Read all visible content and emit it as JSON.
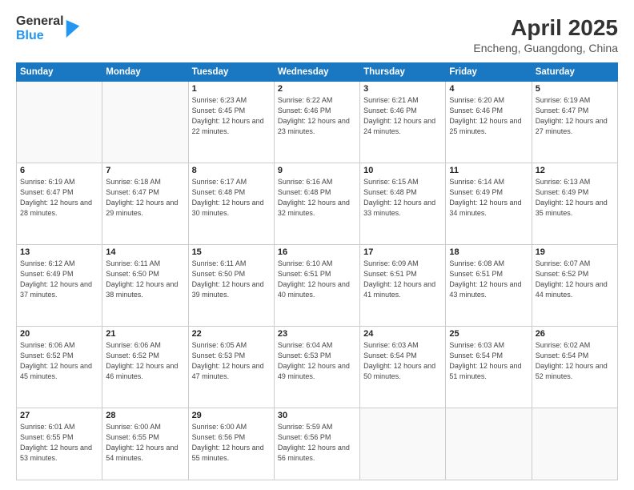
{
  "logo": {
    "general": "General",
    "blue": "Blue"
  },
  "header": {
    "title": "April 2025",
    "subtitle": "Encheng, Guangdong, China"
  },
  "weekdays": [
    "Sunday",
    "Monday",
    "Tuesday",
    "Wednesday",
    "Thursday",
    "Friday",
    "Saturday"
  ],
  "weeks": [
    [
      {
        "day": "",
        "detail": ""
      },
      {
        "day": "",
        "detail": ""
      },
      {
        "day": "1",
        "detail": "Sunrise: 6:23 AM\nSunset: 6:45 PM\nDaylight: 12 hours and 22 minutes."
      },
      {
        "day": "2",
        "detail": "Sunrise: 6:22 AM\nSunset: 6:46 PM\nDaylight: 12 hours and 23 minutes."
      },
      {
        "day": "3",
        "detail": "Sunrise: 6:21 AM\nSunset: 6:46 PM\nDaylight: 12 hours and 24 minutes."
      },
      {
        "day": "4",
        "detail": "Sunrise: 6:20 AM\nSunset: 6:46 PM\nDaylight: 12 hours and 25 minutes."
      },
      {
        "day": "5",
        "detail": "Sunrise: 6:19 AM\nSunset: 6:47 PM\nDaylight: 12 hours and 27 minutes."
      }
    ],
    [
      {
        "day": "6",
        "detail": "Sunrise: 6:19 AM\nSunset: 6:47 PM\nDaylight: 12 hours and 28 minutes."
      },
      {
        "day": "7",
        "detail": "Sunrise: 6:18 AM\nSunset: 6:47 PM\nDaylight: 12 hours and 29 minutes."
      },
      {
        "day": "8",
        "detail": "Sunrise: 6:17 AM\nSunset: 6:48 PM\nDaylight: 12 hours and 30 minutes."
      },
      {
        "day": "9",
        "detail": "Sunrise: 6:16 AM\nSunset: 6:48 PM\nDaylight: 12 hours and 32 minutes."
      },
      {
        "day": "10",
        "detail": "Sunrise: 6:15 AM\nSunset: 6:48 PM\nDaylight: 12 hours and 33 minutes."
      },
      {
        "day": "11",
        "detail": "Sunrise: 6:14 AM\nSunset: 6:49 PM\nDaylight: 12 hours and 34 minutes."
      },
      {
        "day": "12",
        "detail": "Sunrise: 6:13 AM\nSunset: 6:49 PM\nDaylight: 12 hours and 35 minutes."
      }
    ],
    [
      {
        "day": "13",
        "detail": "Sunrise: 6:12 AM\nSunset: 6:49 PM\nDaylight: 12 hours and 37 minutes."
      },
      {
        "day": "14",
        "detail": "Sunrise: 6:11 AM\nSunset: 6:50 PM\nDaylight: 12 hours and 38 minutes."
      },
      {
        "day": "15",
        "detail": "Sunrise: 6:11 AM\nSunset: 6:50 PM\nDaylight: 12 hours and 39 minutes."
      },
      {
        "day": "16",
        "detail": "Sunrise: 6:10 AM\nSunset: 6:51 PM\nDaylight: 12 hours and 40 minutes."
      },
      {
        "day": "17",
        "detail": "Sunrise: 6:09 AM\nSunset: 6:51 PM\nDaylight: 12 hours and 41 minutes."
      },
      {
        "day": "18",
        "detail": "Sunrise: 6:08 AM\nSunset: 6:51 PM\nDaylight: 12 hours and 43 minutes."
      },
      {
        "day": "19",
        "detail": "Sunrise: 6:07 AM\nSunset: 6:52 PM\nDaylight: 12 hours and 44 minutes."
      }
    ],
    [
      {
        "day": "20",
        "detail": "Sunrise: 6:06 AM\nSunset: 6:52 PM\nDaylight: 12 hours and 45 minutes."
      },
      {
        "day": "21",
        "detail": "Sunrise: 6:06 AM\nSunset: 6:52 PM\nDaylight: 12 hours and 46 minutes."
      },
      {
        "day": "22",
        "detail": "Sunrise: 6:05 AM\nSunset: 6:53 PM\nDaylight: 12 hours and 47 minutes."
      },
      {
        "day": "23",
        "detail": "Sunrise: 6:04 AM\nSunset: 6:53 PM\nDaylight: 12 hours and 49 minutes."
      },
      {
        "day": "24",
        "detail": "Sunrise: 6:03 AM\nSunset: 6:54 PM\nDaylight: 12 hours and 50 minutes."
      },
      {
        "day": "25",
        "detail": "Sunrise: 6:03 AM\nSunset: 6:54 PM\nDaylight: 12 hours and 51 minutes."
      },
      {
        "day": "26",
        "detail": "Sunrise: 6:02 AM\nSunset: 6:54 PM\nDaylight: 12 hours and 52 minutes."
      }
    ],
    [
      {
        "day": "27",
        "detail": "Sunrise: 6:01 AM\nSunset: 6:55 PM\nDaylight: 12 hours and 53 minutes."
      },
      {
        "day": "28",
        "detail": "Sunrise: 6:00 AM\nSunset: 6:55 PM\nDaylight: 12 hours and 54 minutes."
      },
      {
        "day": "29",
        "detail": "Sunrise: 6:00 AM\nSunset: 6:56 PM\nDaylight: 12 hours and 55 minutes."
      },
      {
        "day": "30",
        "detail": "Sunrise: 5:59 AM\nSunset: 6:56 PM\nDaylight: 12 hours and 56 minutes."
      },
      {
        "day": "",
        "detail": ""
      },
      {
        "day": "",
        "detail": ""
      },
      {
        "day": "",
        "detail": ""
      }
    ]
  ]
}
